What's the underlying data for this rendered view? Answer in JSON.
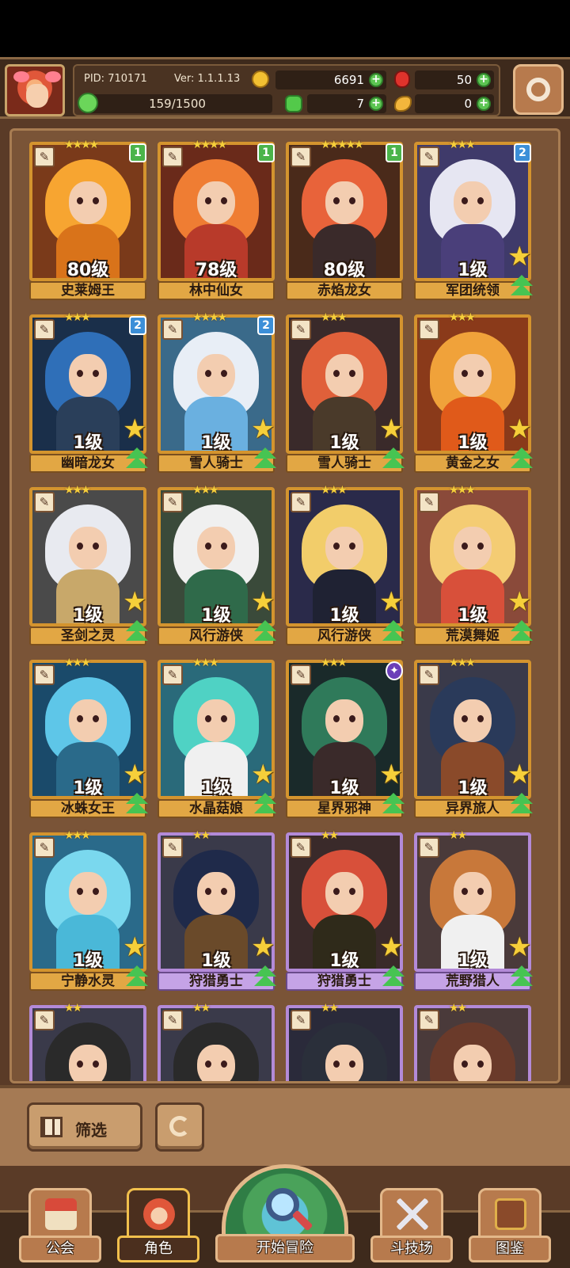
{
  "status_bar": {},
  "header": {
    "pid": "PID: 710171",
    "version": "Ver: 1.1.1.13",
    "gold": "6691",
    "rubies": "50",
    "stamina": "159/1500",
    "clovers": "7",
    "horns": "0",
    "icons": {
      "avatar": "player-avatar",
      "gold": "coin-icon",
      "ruby": "ruby-icon",
      "clover": "clover-icon",
      "horn": "horn-icon",
      "settings": "gear-icon"
    }
  },
  "heroes": [
    {
      "name": "史莱姆王",
      "level": "80级",
      "stars": "★★★★",
      "badge": "1",
      "badge_type": "green",
      "rarity": "gold",
      "hair": "#f7a531",
      "outfit": "#d9731a",
      "bg": "#7a3a1a",
      "show_star": false
    },
    {
      "name": "林中仙女",
      "level": "78级",
      "stars": "★★★★",
      "badge": "1",
      "badge_type": "green",
      "rarity": "gold",
      "hair": "#ef7d33",
      "outfit": "#b83a2a",
      "bg": "#6a2a1a",
      "show_star": false
    },
    {
      "name": "赤焰龙女",
      "level": "80级",
      "stars": "★★★★★",
      "badge": "1",
      "badge_type": "green",
      "rarity": "gold",
      "hair": "#e8633a",
      "outfit": "#3a2a2a",
      "bg": "#4a2a1a",
      "show_star": false
    },
    {
      "name": "军团统领",
      "level": "1级",
      "stars": "★★★",
      "badge": "2",
      "badge_type": "blue",
      "rarity": "gold",
      "hair": "#e6e6f2",
      "outfit": "#4a3f7a",
      "bg": "#3f3a6a",
      "show_star": true
    },
    {
      "name": "幽暗龙女",
      "level": "1级",
      "stars": "★★★",
      "badge": "2",
      "badge_type": "blue",
      "rarity": "gold",
      "hair": "#2f6fb8",
      "outfit": "#2a3f5a",
      "bg": "#1a2f4a",
      "show_star": true
    },
    {
      "name": "雪人骑士",
      "level": "1级",
      "stars": "★★★★",
      "badge": "2",
      "badge_type": "blue",
      "rarity": "gold",
      "hair": "#e8eef6",
      "outfit": "#6ab0e0",
      "bg": "#3a6a8a",
      "show_star": true
    },
    {
      "name": "雪人骑士",
      "level": "1级",
      "stars": "★★★",
      "badge": "",
      "badge_type": "",
      "rarity": "gold",
      "hair": "#e0603a",
      "outfit": "#4a3a2a",
      "bg": "#3a2a2a",
      "show_star": true
    },
    {
      "name": "黄金之女",
      "level": "1级",
      "stars": "★★★",
      "badge": "",
      "badge_type": "",
      "rarity": "gold",
      "hair": "#f0a23a",
      "outfit": "#e05a1a",
      "bg": "#8a3a1a",
      "show_star": true
    },
    {
      "name": "圣剑之灵",
      "level": "1级",
      "stars": "★★★",
      "badge": "",
      "badge_type": "",
      "rarity": "gold",
      "hair": "#e8eaf0",
      "outfit": "#c8a86a",
      "bg": "#4a4a4a",
      "show_star": true
    },
    {
      "name": "风行游侠",
      "level": "1级",
      "stars": "★★★",
      "badge": "",
      "badge_type": "",
      "rarity": "gold",
      "hair": "#f0f0f0",
      "outfit": "#2f6a4a",
      "bg": "#3a4a3a",
      "show_star": true
    },
    {
      "name": "风行游侠",
      "level": "1级",
      "stars": "★★★",
      "badge": "",
      "badge_type": "",
      "rarity": "gold",
      "hair": "#f2cd6a",
      "outfit": "#1f2233",
      "bg": "#2a2a4a",
      "show_star": true
    },
    {
      "name": "荒漠舞姬",
      "level": "1级",
      "stars": "★★★",
      "badge": "",
      "badge_type": "",
      "rarity": "gold",
      "hair": "#f4cc73",
      "outfit": "#d8503a",
      "bg": "#8a4a3a",
      "show_star": true
    },
    {
      "name": "冰蛛女王",
      "level": "1级",
      "stars": "★★★",
      "badge": "",
      "badge_type": "",
      "rarity": "gold",
      "hair": "#5ec6e8",
      "outfit": "#2a6a8a",
      "bg": "#1a4a6a",
      "show_star": true
    },
    {
      "name": "水晶菇娘",
      "level": "1级",
      "stars": "★★★",
      "badge": "",
      "badge_type": "",
      "rarity": "gold",
      "hair": "#4fd2c4",
      "outfit": "#f0f0f0",
      "bg": "#2a6a7a",
      "show_star": true
    },
    {
      "name": "星界邪神",
      "level": "1级",
      "stars": "★★★",
      "badge": "✦",
      "badge_type": "purple",
      "rarity": "gold",
      "hair": "#2f7a5a",
      "outfit": "#3a2a2a",
      "bg": "#1a2a2a",
      "show_star": true
    },
    {
      "name": "异界旅人",
      "level": "1级",
      "stars": "★★★",
      "badge": "",
      "badge_type": "",
      "rarity": "gold",
      "hair": "#2a3a5a",
      "outfit": "#8a4a2a",
      "bg": "#3a3a4a",
      "show_star": true
    },
    {
      "name": "宁静水灵",
      "level": "1级",
      "stars": "★★★",
      "badge": "",
      "badge_type": "",
      "rarity": "gold",
      "hair": "#7ad8ee",
      "outfit": "#4ab8d8",
      "bg": "#2a6a8a",
      "show_star": true
    },
    {
      "name": "狩猎勇士",
      "level": "1级",
      "stars": "★★",
      "badge": "",
      "badge_type": "",
      "rarity": "purple",
      "hair": "#1f2a4a",
      "outfit": "#6a4a2a",
      "bg": "#3a3a4a",
      "show_star": true
    },
    {
      "name": "狩猎勇士",
      "level": "1级",
      "stars": "★★",
      "badge": "",
      "badge_type": "",
      "rarity": "purple",
      "hair": "#d8503a",
      "outfit": "#2f2a1a",
      "bg": "#3a2a2a",
      "show_star": true
    },
    {
      "name": "荒野猎人",
      "level": "1级",
      "stars": "★★",
      "badge": "",
      "badge_type": "",
      "rarity": "purple",
      "hair": "#c8783a",
      "outfit": "#f0f0f0",
      "bg": "#4a3a3a",
      "show_star": true
    },
    {
      "name": "",
      "level": "",
      "stars": "★★",
      "badge": "",
      "badge_type": "",
      "rarity": "purple",
      "hair": "#2a2a2a",
      "outfit": "#f0f0f0",
      "bg": "#3a3a4a",
      "show_star": false
    },
    {
      "name": "",
      "level": "",
      "stars": "★★",
      "badge": "",
      "badge_type": "",
      "rarity": "purple",
      "hair": "#2a2a2a",
      "outfit": "#3a5a4a",
      "bg": "#3a3a4a",
      "show_star": false
    },
    {
      "name": "",
      "level": "",
      "stars": "★★",
      "badge": "",
      "badge_type": "",
      "rarity": "purple",
      "hair": "#2a2f3a",
      "outfit": "#3a3a4a",
      "bg": "#2a2a3a",
      "show_star": false
    },
    {
      "name": "",
      "level": "",
      "stars": "★★",
      "badge": "",
      "badge_type": "",
      "rarity": "purple",
      "hair": "#6a3a2a",
      "outfit": "#e8eef6",
      "bg": "#4a3a3a",
      "show_star": false
    }
  ],
  "controls": {
    "filter_label": "筛选",
    "icons": {
      "filter": "grid-icon",
      "refresh": "refresh-icon"
    }
  },
  "nav": {
    "guild": "公会",
    "character": "角色",
    "start_adventure": "开始冒险",
    "arena": "斗技场",
    "codex": "图鉴",
    "active": "character"
  }
}
